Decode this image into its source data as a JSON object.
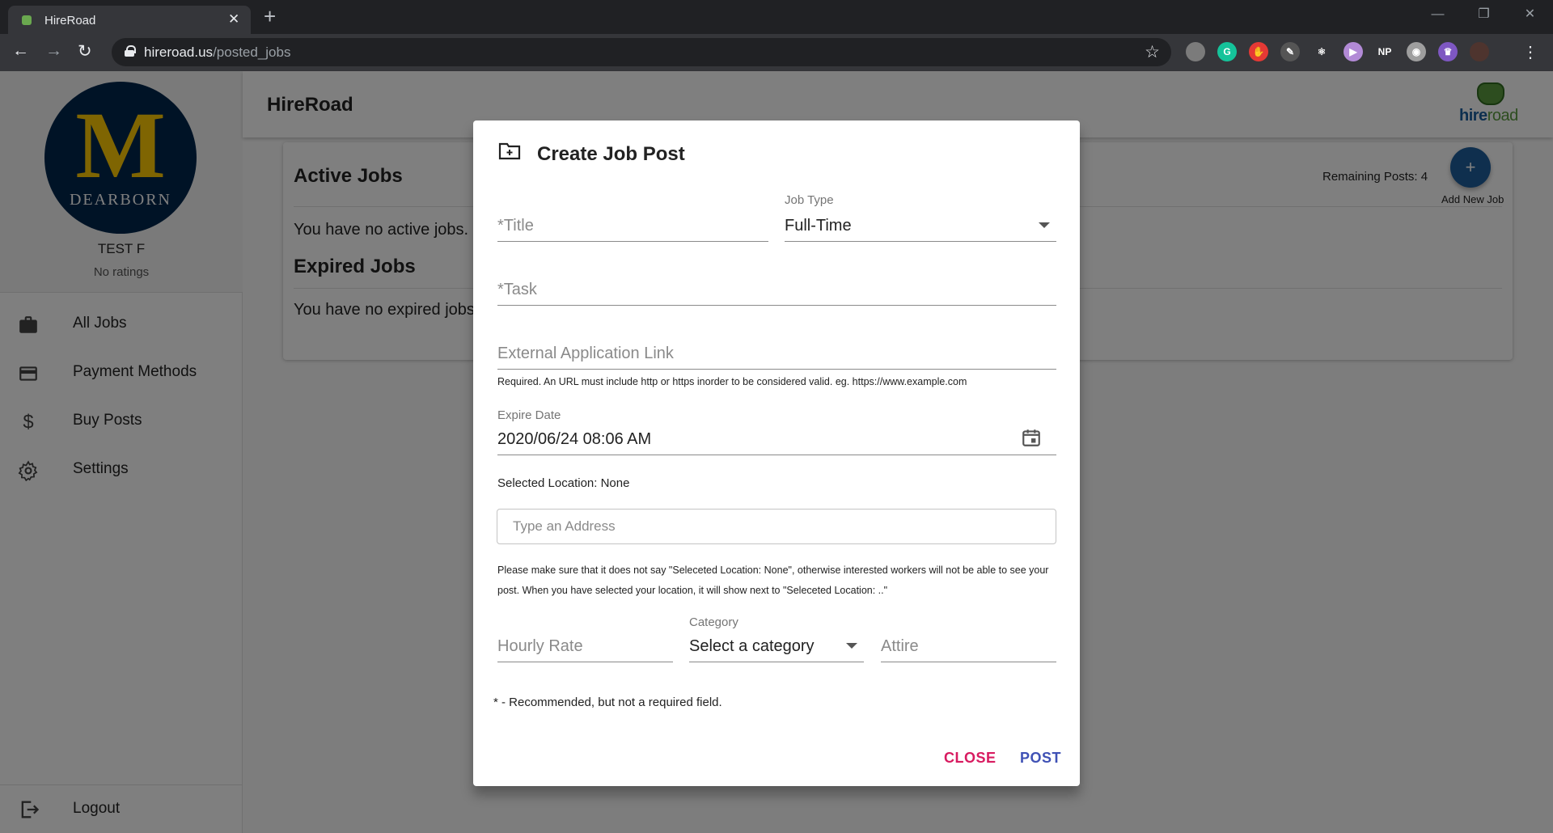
{
  "browser": {
    "tab_title": "HireRoad",
    "tab_close": "✕",
    "new_tab": "+",
    "url_host": "hireroad.us",
    "url_path": "/posted_jobs",
    "back": "←",
    "forward": "→",
    "reload": "↻",
    "star": "☆",
    "menu": "⋮",
    "window_controls": {
      "minimize": "—",
      "restore": "❐",
      "close": "✕"
    },
    "extensions": [
      {
        "name": "extension-icon",
        "label": "",
        "color": "#7b7b7b"
      },
      {
        "name": "grammarly-icon",
        "label": "G",
        "color": "#15c39a"
      },
      {
        "name": "adblock-icon",
        "label": "✋",
        "color": "#e53935"
      },
      {
        "name": "pen-icon",
        "label": "✎",
        "color": "#555555"
      },
      {
        "name": "react-icon",
        "label": "⚛",
        "color": "#35363a"
      },
      {
        "name": "play-icon",
        "label": "▶",
        "color": "#b28ad6"
      },
      {
        "name": "np-icon",
        "label": "NP",
        "color": "#35363a"
      },
      {
        "name": "record-icon",
        "label": "◉",
        "color": "#9e9e9e"
      },
      {
        "name": "purple-extension-icon",
        "label": "♛",
        "color": "#7e57c2"
      },
      {
        "name": "profile-avatar-icon",
        "label": "",
        "color": "#4e342e"
      }
    ]
  },
  "sidebar": {
    "logo_letter": "M",
    "logo_text": "DEARBORN",
    "user_name": "TEST F",
    "rating": "No ratings",
    "items": [
      {
        "label": "All Jobs",
        "icon": "briefcase-icon"
      },
      {
        "label": "Payment Methods",
        "icon": "credit-card-icon"
      },
      {
        "label": "Buy Posts",
        "icon": "dollar-icon"
      },
      {
        "label": "Settings",
        "icon": "gear-icon"
      }
    ],
    "logout": "Logout"
  },
  "header": {
    "brand": "HireRoad",
    "logo_word_a": "hire",
    "logo_word_b": "road"
  },
  "jobs": {
    "active_title": "Active Jobs",
    "active_empty": "You have no active jobs.",
    "expired_title": "Expired Jobs",
    "expired_empty": "You have no expired jobs.",
    "remaining": "Remaining Posts: 4",
    "add_icon": "+",
    "add_label": "Add New Job"
  },
  "dialog": {
    "title": "Create Job Post",
    "title_placeholder": "*Title",
    "job_type_label": "Job Type",
    "job_type_value": "Full-Time",
    "task_placeholder": "*Task",
    "external_link_placeholder": "External Application Link",
    "url_helper": "Required. An URL must include http or https inorder to be considered valid. eg. https://www.example.com",
    "expire_label": "Expire Date",
    "expire_value": "2020/06/24 08:06 AM",
    "location_text": "Selected Location: None",
    "address_placeholder": "Type an Address",
    "location_warning": "Please make sure that it does not say \"Seleceted Location: None\", otherwise interested workers will not be able to see your post. When you have selected your location, it will show next to \"Seleceted Location: ..\"",
    "hourly_placeholder": "Hourly Rate",
    "category_label": "Category",
    "category_value": "Select a category",
    "attire_placeholder": "Attire",
    "recommended_note": "* - Recommended, but not a required field.",
    "close_label": "CLOSE",
    "post_label": "POST"
  },
  "colors": {
    "chrome_dark": "#202124",
    "fab_blue": "#1f5f9d",
    "close_pink": "#d81b60",
    "post_indigo": "#3f51b5",
    "umich_blue": "#00274c",
    "umich_maize": "#ffcb05"
  }
}
